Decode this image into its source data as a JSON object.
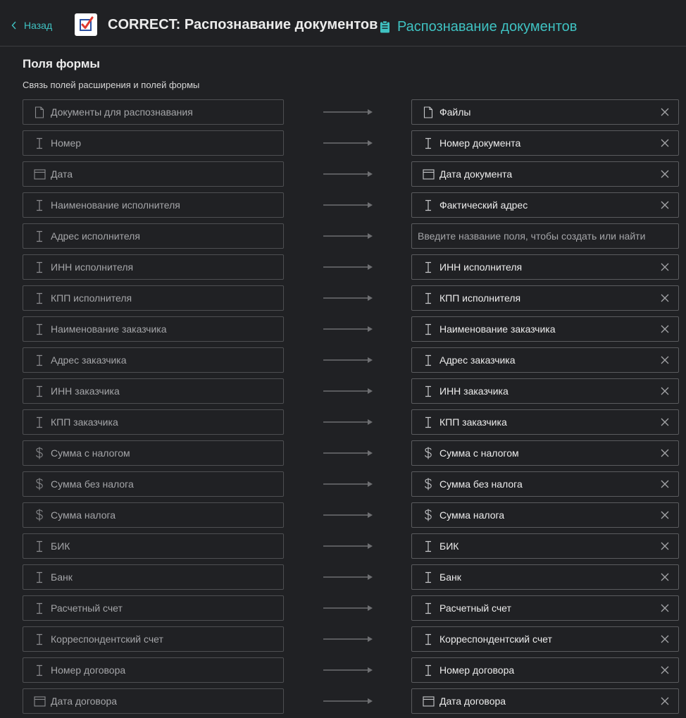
{
  "header": {
    "back_label": "Назад",
    "app_title": "CORRECT: Распознавание документов",
    "crumb_label": "Распознавание документов"
  },
  "section": {
    "title": "Поля формы",
    "subtitle": "Связь полей расширения и полей формы"
  },
  "mappings": [
    {
      "source": {
        "icon": "file-icon",
        "label": "Документы для распознавания"
      },
      "target": {
        "icon": "file-icon",
        "label": "Файлы"
      }
    },
    {
      "source": {
        "icon": "text-cursor-icon",
        "label": "Номер"
      },
      "target": {
        "icon": "text-cursor-icon",
        "label": "Номер документа"
      }
    },
    {
      "source": {
        "icon": "calendar-icon",
        "label": "Дата"
      },
      "target": {
        "icon": "calendar-icon",
        "label": "Дата документа"
      }
    },
    {
      "source": {
        "icon": "text-cursor-icon",
        "label": "Наименование исполнителя"
      },
      "target": {
        "icon": "text-cursor-icon",
        "label": "Фактический адрес"
      }
    },
    {
      "source": {
        "icon": "text-cursor-icon",
        "label": "Адрес исполнителя"
      },
      "target": {
        "placeholder": "Введите название поля, чтобы создать или найти"
      }
    },
    {
      "source": {
        "icon": "text-cursor-icon",
        "label": "ИНН исполнителя"
      },
      "target": {
        "icon": "text-cursor-icon",
        "label": "ИНН исполнителя"
      }
    },
    {
      "source": {
        "icon": "text-cursor-icon",
        "label": "КПП исполнителя"
      },
      "target": {
        "icon": "text-cursor-icon",
        "label": "КПП исполнителя"
      }
    },
    {
      "source": {
        "icon": "text-cursor-icon",
        "label": "Наименование заказчика"
      },
      "target": {
        "icon": "text-cursor-icon",
        "label": "Наименование заказчика"
      }
    },
    {
      "source": {
        "icon": "text-cursor-icon",
        "label": "Адрес заказчика"
      },
      "target": {
        "icon": "text-cursor-icon",
        "label": "Адрес заказчика"
      }
    },
    {
      "source": {
        "icon": "text-cursor-icon",
        "label": "ИНН заказчика"
      },
      "target": {
        "icon": "text-cursor-icon",
        "label": "ИНН заказчика"
      }
    },
    {
      "source": {
        "icon": "text-cursor-icon",
        "label": "КПП заказчика"
      },
      "target": {
        "icon": "text-cursor-icon",
        "label": "КПП заказчика"
      }
    },
    {
      "source": {
        "icon": "dollar-icon",
        "label": "Сумма с налогом"
      },
      "target": {
        "icon": "dollar-icon",
        "label": "Сумма с налогом"
      }
    },
    {
      "source": {
        "icon": "dollar-icon",
        "label": "Сумма без налога"
      },
      "target": {
        "icon": "dollar-icon",
        "label": "Сумма без налога"
      }
    },
    {
      "source": {
        "icon": "dollar-icon",
        "label": "Сумма налога"
      },
      "target": {
        "icon": "dollar-icon",
        "label": "Сумма налога"
      }
    },
    {
      "source": {
        "icon": "text-cursor-icon",
        "label": "БИК"
      },
      "target": {
        "icon": "text-cursor-icon",
        "label": "БИК"
      }
    },
    {
      "source": {
        "icon": "text-cursor-icon",
        "label": "Банк"
      },
      "target": {
        "icon": "text-cursor-icon",
        "label": "Банк"
      }
    },
    {
      "source": {
        "icon": "text-cursor-icon",
        "label": "Расчетный счет"
      },
      "target": {
        "icon": "text-cursor-icon",
        "label": "Расчетный счет"
      }
    },
    {
      "source": {
        "icon": "text-cursor-icon",
        "label": "Корреспондентский счет"
      },
      "target": {
        "icon": "text-cursor-icon",
        "label": "Корреспондентский счет"
      }
    },
    {
      "source": {
        "icon": "text-cursor-icon",
        "label": "Номер договора"
      },
      "target": {
        "icon": "text-cursor-icon",
        "label": "Номер договора"
      }
    },
    {
      "source": {
        "icon": "calendar-icon",
        "label": "Дата договора"
      },
      "target": {
        "icon": "calendar-icon",
        "label": "Дата договора"
      }
    }
  ],
  "colors": {
    "background": "#202124",
    "accent": "#3fc2c2",
    "border": "#4e4f52",
    "text": "#ececec",
    "muted_text": "#a4a5a8"
  }
}
